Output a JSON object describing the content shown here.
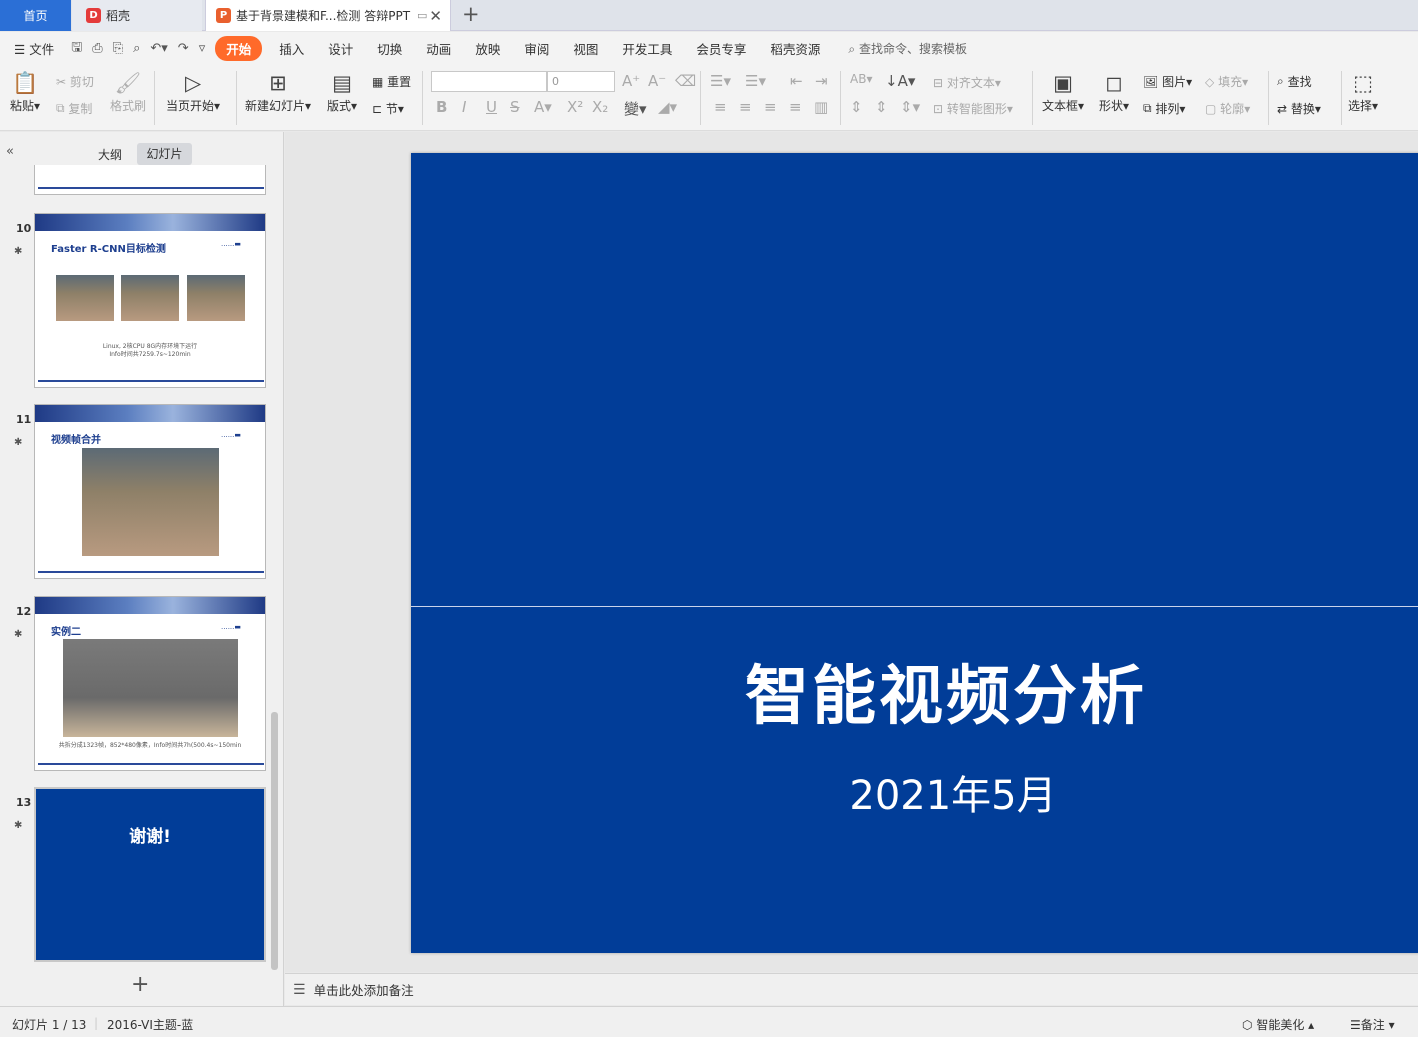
{
  "tabs": {
    "home": "首页",
    "daoke": "稻壳",
    "doc": "基于背景建模和F...检测 答辩PPT"
  },
  "menu": {
    "file": "文件",
    "items": [
      "开始",
      "插入",
      "设计",
      "切换",
      "动画",
      "放映",
      "审阅",
      "视图",
      "开发工具",
      "会员专享",
      "稻壳资源"
    ],
    "search": "查找命令、搜索模板"
  },
  "ribbon": {
    "paste": "粘贴",
    "cut": "剪切",
    "copy": "复制",
    "format_painter": "格式刷",
    "from_current": "当页开始",
    "new_slide": "新建幻灯片",
    "layout": "版式",
    "reset": "重置",
    "section": "节",
    "font_size": "0",
    "align_text": "对齐文本",
    "convert_smartart": "转智能图形",
    "textbox": "文本框",
    "shape": "形状",
    "picture": "图片",
    "arrange": "排列",
    "fill": "填充",
    "outline": "轮廓",
    "find": "查找",
    "replace": "替换",
    "select": "选择"
  },
  "panel": {
    "outline": "大纲",
    "slides": "幻灯片"
  },
  "thumbnails": [
    {
      "num": "10",
      "title": "Faster R-CNN目标检测",
      "caption1": "Linux, 2核CPU 8G内存环境下运行",
      "caption2": "Info时间共7259.7s~120min"
    },
    {
      "num": "11",
      "title": "视频帧合并"
    },
    {
      "num": "12",
      "title": "实例二",
      "caption1": "共拆分成1323帧，852*480像素，Info时间共7h(500.4s~150min"
    },
    {
      "num": "13",
      "title": "谢谢!"
    }
  ],
  "slide": {
    "title": "智能视频分析",
    "subtitle": "2021年5月",
    "background": "#013d98"
  },
  "notes": "单击此处添加备注",
  "status": {
    "slide_counter": "幻灯片 1 / 13",
    "theme": "2016-VI主题-蓝",
    "beautify": "智能美化",
    "notes": "备注"
  }
}
